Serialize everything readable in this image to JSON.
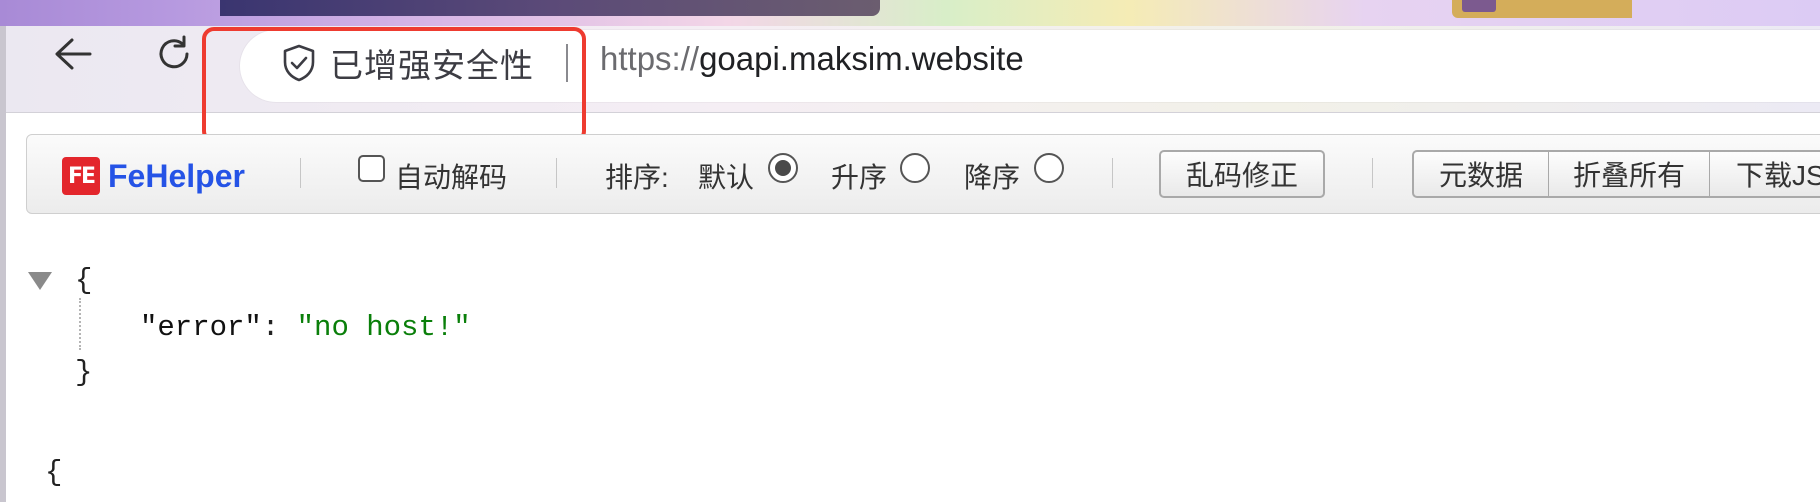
{
  "browser": {
    "security_label": "已增强安全性",
    "url_scheme": "https://",
    "url_host": "goapi.maksim.website"
  },
  "fehelper": {
    "name": "FeHelper",
    "badge": "FE",
    "auto_decode_label": "自动解码",
    "sort_label": "排序:",
    "sort_options": [
      {
        "label": "默认",
        "selected": true
      },
      {
        "label": "升序",
        "selected": false
      },
      {
        "label": "降序",
        "selected": false
      }
    ],
    "fix_garbled_button": "乱码修正",
    "metadata_button": "元数据",
    "collapse_all_button": "折叠所有",
    "download_button": "下载JS"
  },
  "json_view": {
    "open_brace": "{",
    "close_brace": "}",
    "entries": [
      {
        "key": "\"error\"",
        "colon": ": ",
        "value": "\"no host!\""
      }
    ],
    "raw_open_brace": "{"
  },
  "colors": {
    "highlight_box": "#ee3b30",
    "fehelper_blue": "#2553e6",
    "fe_badge_red": "#e3262c",
    "json_string": "#0a7f0a"
  },
  "icons": {
    "back": "arrow-left-icon",
    "reload": "reload-icon",
    "security": "shield-check-icon",
    "collapse": "triangle-down-icon"
  }
}
